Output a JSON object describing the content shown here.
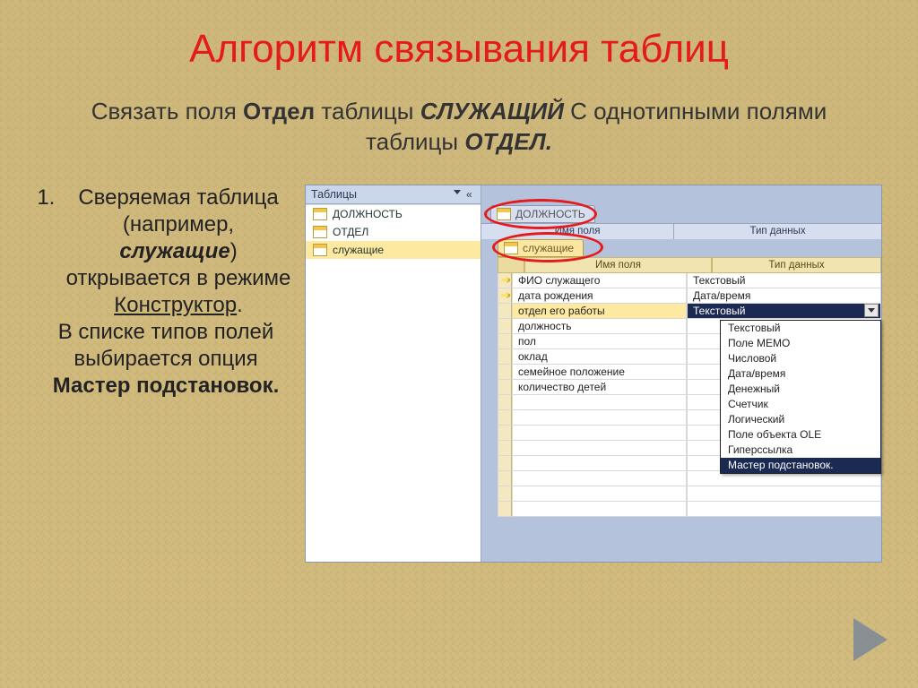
{
  "title": "Алгоритм связывания таблиц",
  "subtitle_parts": {
    "p1": "Связать поля ",
    "b1": "Отдел",
    "p2": " таблицы ",
    "bi1": "СЛУЖАЩИЙ",
    "p3": " С однотипными полями таблицы ",
    "bi2": "ОТДЕЛ."
  },
  "bullet": {
    "line1a": "Сверяемая таблица (например, ",
    "line1b": "служащие",
    "line1c": ") открывается в режиме ",
    "line1d": "Конструктор",
    "line1e": ".",
    "line2a": "В списке типов полей выбирается опция ",
    "line2b": "Мастер подстановок."
  },
  "nav": {
    "header": "Таблицы",
    "items": [
      "ДОЛЖНОСТЬ",
      "ОТДЕЛ",
      "служащие"
    ]
  },
  "tabs": {
    "tab1": "ДОЛЖНОСТЬ",
    "tab2": "служащие",
    "col1": "Имя поля",
    "col2": "Тип данных"
  },
  "grid": {
    "headers": [
      "Имя поля",
      "Тип данных"
    ],
    "rows": [
      {
        "key": true,
        "name": "ФИО служащего",
        "type": "Текстовый"
      },
      {
        "key": true,
        "name": "дата рождения",
        "type": "Дата/время"
      },
      {
        "key": false,
        "name": "отдел его работы",
        "type": "Текстовый",
        "active": true
      },
      {
        "key": false,
        "name": "должность",
        "type": ""
      },
      {
        "key": false,
        "name": "пол",
        "type": ""
      },
      {
        "key": false,
        "name": "оклад",
        "type": ""
      },
      {
        "key": false,
        "name": "семейное положение",
        "type": ""
      },
      {
        "key": false,
        "name": "количество детей",
        "type": ""
      }
    ]
  },
  "dropdown": [
    "Текстовый",
    "Поле МЕМО",
    "Числовой",
    "Дата/время",
    "Денежный",
    "Счетчик",
    "Логический",
    "Поле объекта OLE",
    "Гиперссылка",
    "Мастер подстановок."
  ],
  "dropdown_selected": "Мастер подстановок."
}
